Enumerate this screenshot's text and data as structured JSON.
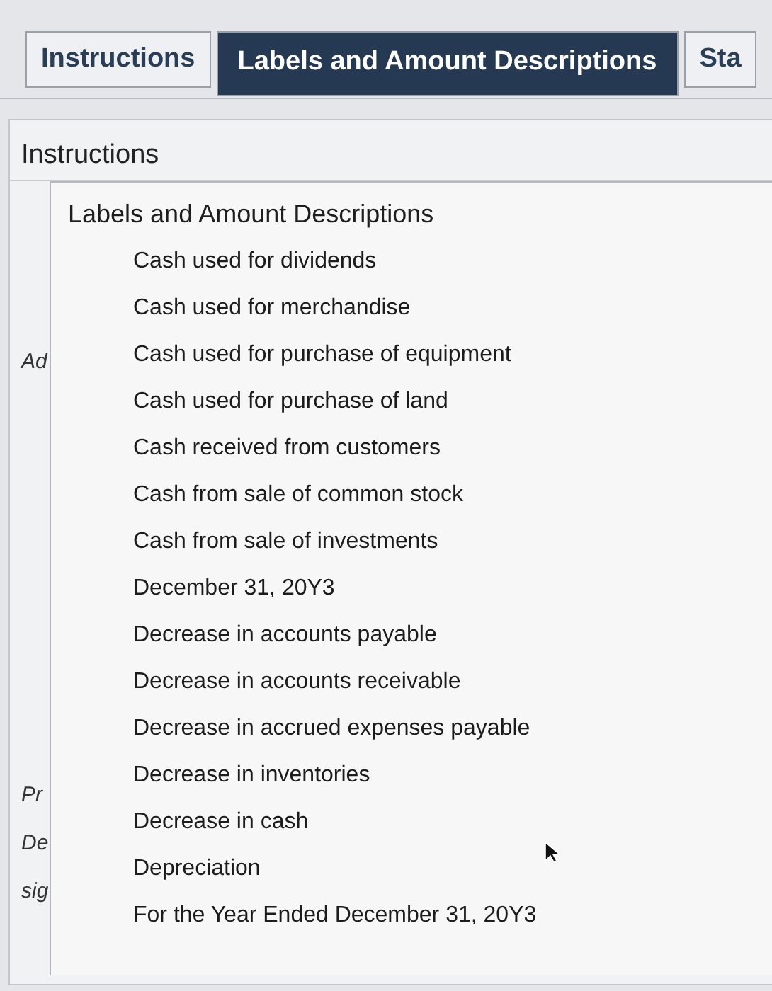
{
  "tabs": [
    {
      "label": "Instructions",
      "selected": false
    },
    {
      "label": "Labels and Amount Descriptions",
      "selected": true
    },
    {
      "label": "Sta",
      "selected": false
    }
  ],
  "panel": {
    "title": "Instructions"
  },
  "background_fragments": [
    "Ad",
    "Pr",
    "De",
    "sig"
  ],
  "list": {
    "title": "Labels and Amount Descriptions",
    "items": [
      "Cash used for dividends",
      "Cash used for merchandise",
      "Cash used for purchase of equipment",
      "Cash used for purchase of land",
      "Cash received from customers",
      "Cash from sale of common stock",
      "Cash from sale of investments",
      "December 31, 20Y3",
      "Decrease in accounts payable",
      "Decrease in accounts receivable",
      "Decrease in accrued expenses payable",
      "Decrease in inventories",
      "Decrease in cash",
      "Depreciation",
      "For the Year Ended December 31, 20Y3"
    ]
  }
}
